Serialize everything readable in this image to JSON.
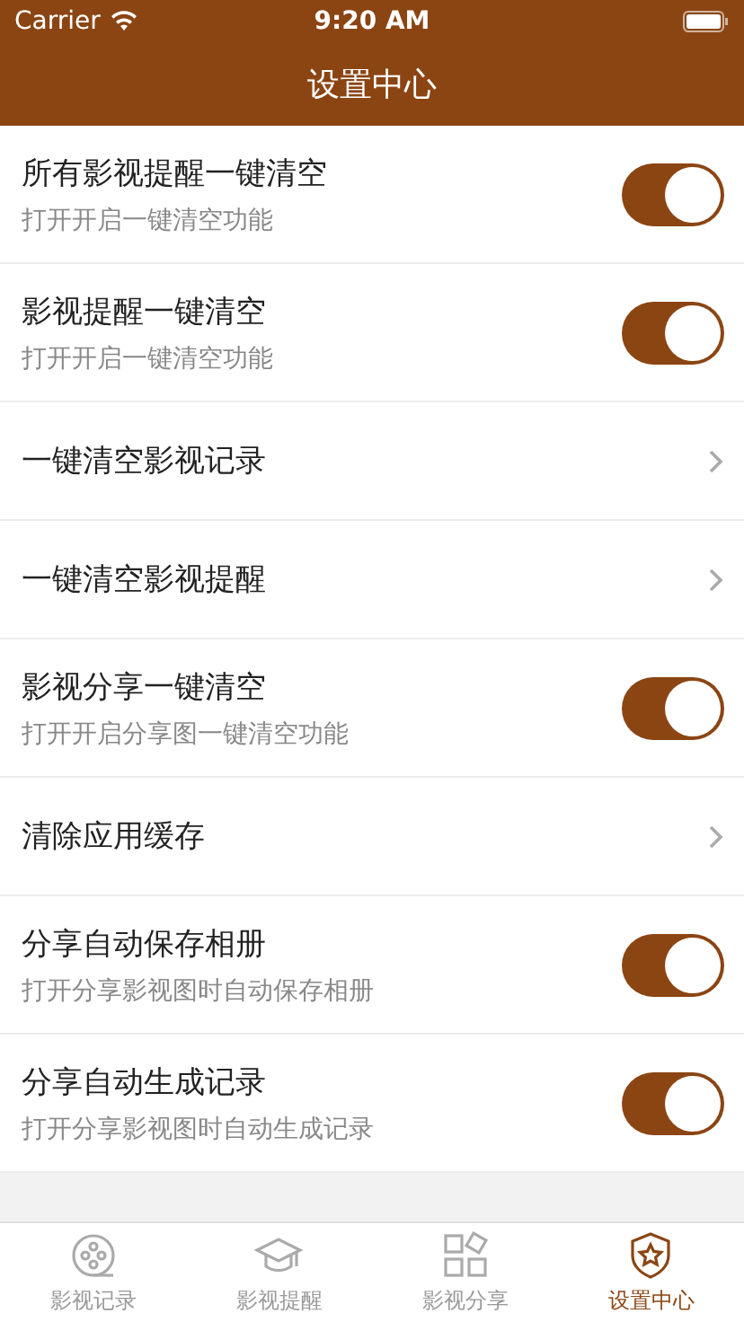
{
  "status_bar": {
    "carrier": "Carrier",
    "time": "9:20 AM"
  },
  "title": "设置中心",
  "settings": [
    {
      "kind": "toggle",
      "title": "所有影视提醒一键清空",
      "subtitle": "打开开启一键清空功能",
      "on": true
    },
    {
      "kind": "toggle",
      "title": "影视提醒一键清空",
      "subtitle": "打开开启一键清空功能",
      "on": true
    },
    {
      "kind": "link",
      "title": "一键清空影视记录"
    },
    {
      "kind": "link",
      "title": "一键清空影视提醒"
    },
    {
      "kind": "toggle",
      "title": "影视分享一键清空",
      "subtitle": "打开开启分享图一键清空功能",
      "on": true
    },
    {
      "kind": "link",
      "title": "清除应用缓存"
    },
    {
      "kind": "toggle",
      "title": "分享自动保存相册",
      "subtitle": "打开分享影视图时自动保存相册",
      "on": true
    },
    {
      "kind": "toggle",
      "title": "分享自动生成记录",
      "subtitle": "打开分享影视图时自动生成记录",
      "on": true
    }
  ],
  "tabs": [
    {
      "label": "影视记录",
      "selected": false
    },
    {
      "label": "影视提醒",
      "selected": false
    },
    {
      "label": "影视分享",
      "selected": false
    },
    {
      "label": "设置中心",
      "selected": true
    }
  ]
}
